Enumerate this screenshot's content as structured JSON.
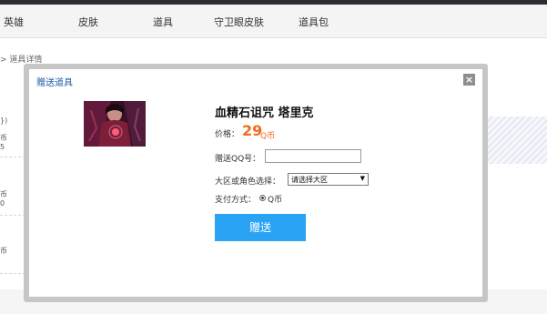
{
  "nav": {
    "items": [
      "英雄",
      "皮肤",
      "道具",
      "守卫眼皮肤",
      "道具包"
    ]
  },
  "breadcrumb": "> 道具详情",
  "background_fragments": [
    "})",
    "币",
    "5",
    "币",
    "0",
    "币"
  ],
  "modal": {
    "title": "赠送道具",
    "close_glyph": "×",
    "item_name": "血精石诅咒 塔里克",
    "price_label": "价格：",
    "price_value": "29",
    "price_unit": "Q币",
    "qq_label": "赠送QQ号：",
    "qq_value": "",
    "region_label": "大区或角色选择：",
    "region_selected": "请选择大区",
    "pay_label": "支付方式：",
    "pay_option": "Q币",
    "gift_button": "赠送"
  },
  "colors": {
    "title_blue": "#1f5da8",
    "price_orange": "#f26b1d",
    "button_blue": "#2aa3f4"
  },
  "icons": {
    "close": "close-icon",
    "dropdown": "chevron-down-icon",
    "radio": "radio-selected-icon"
  }
}
